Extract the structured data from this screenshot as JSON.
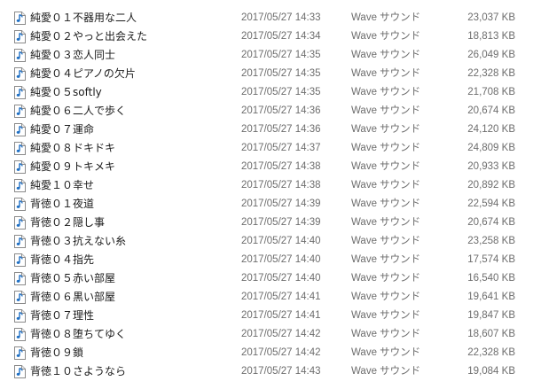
{
  "files": [
    {
      "name": "純愛０１不器用な二人",
      "date": "2017/05/27 14:33",
      "type": "Wave サウンド",
      "size": "23,037 KB"
    },
    {
      "name": "純愛０２やっと出会えた",
      "date": "2017/05/27 14:34",
      "type": "Wave サウンド",
      "size": "18,813 KB"
    },
    {
      "name": "純愛０３恋人同士",
      "date": "2017/05/27 14:35",
      "type": "Wave サウンド",
      "size": "26,049 KB"
    },
    {
      "name": "純愛０４ピアノの欠片",
      "date": "2017/05/27 14:35",
      "type": "Wave サウンド",
      "size": "22,328 KB"
    },
    {
      "name": "純愛０５softly",
      "date": "2017/05/27 14:35",
      "type": "Wave サウンド",
      "size": "21,708 KB"
    },
    {
      "name": "純愛０６二人で歩く",
      "date": "2017/05/27 14:36",
      "type": "Wave サウンド",
      "size": "20,674 KB"
    },
    {
      "name": "純愛０７運命",
      "date": "2017/05/27 14:36",
      "type": "Wave サウンド",
      "size": "24,120 KB"
    },
    {
      "name": "純愛０８ドキドキ",
      "date": "2017/05/27 14:37",
      "type": "Wave サウンド",
      "size": "24,809 KB"
    },
    {
      "name": "純愛０９トキメキ",
      "date": "2017/05/27 14:38",
      "type": "Wave サウンド",
      "size": "20,933 KB"
    },
    {
      "name": "純愛１０幸せ",
      "date": "2017/05/27 14:38",
      "type": "Wave サウンド",
      "size": "20,892 KB"
    },
    {
      "name": "背徳０１夜道",
      "date": "2017/05/27 14:39",
      "type": "Wave サウンド",
      "size": "22,594 KB"
    },
    {
      "name": "背徳０２隠し事",
      "date": "2017/05/27 14:39",
      "type": "Wave サウンド",
      "size": "20,674 KB"
    },
    {
      "name": "背徳０３抗えない糸",
      "date": "2017/05/27 14:40",
      "type": "Wave サウンド",
      "size": "23,258 KB"
    },
    {
      "name": "背徳０４指先",
      "date": "2017/05/27 14:40",
      "type": "Wave サウンド",
      "size": "17,574 KB"
    },
    {
      "name": "背徳０５赤い部屋",
      "date": "2017/05/27 14:40",
      "type": "Wave サウンド",
      "size": "16,540 KB"
    },
    {
      "name": "背徳０６黒い部屋",
      "date": "2017/05/27 14:41",
      "type": "Wave サウンド",
      "size": "19,641 KB"
    },
    {
      "name": "背徳０７理性",
      "date": "2017/05/27 14:41",
      "type": "Wave サウンド",
      "size": "19,847 KB"
    },
    {
      "name": "背徳０８堕ちてゆく",
      "date": "2017/05/27 14:42",
      "type": "Wave サウンド",
      "size": "18,607 KB"
    },
    {
      "name": "背徳０９鎖",
      "date": "2017/05/27 14:42",
      "type": "Wave サウンド",
      "size": "22,328 KB"
    },
    {
      "name": "背徳１０さようなら",
      "date": "2017/05/27 14:43",
      "type": "Wave サウンド",
      "size": "19,084 KB"
    }
  ],
  "icon": "audio-file-icon",
  "colors": {
    "name_text": "#1a1a1a",
    "detail_text": "#6d6d6d",
    "icon_note": "#1e6fc4",
    "background": "#ffffff"
  }
}
